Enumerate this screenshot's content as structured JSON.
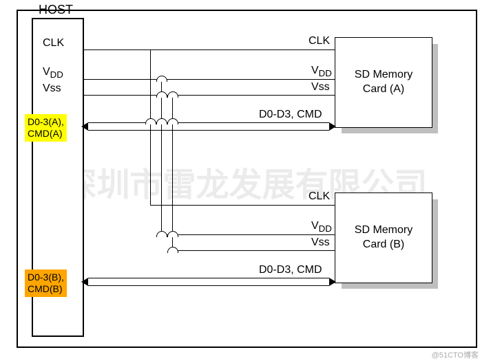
{
  "frame": {
    "title": "HOST"
  },
  "host": {
    "signals": {
      "clk": "CLK",
      "vdd": "V",
      "vdd_sub": "DD",
      "vss": "Vss"
    },
    "highlightA": {
      "line1": "D0-3(A),",
      "line2": "CMD(A)"
    },
    "highlightB": {
      "line1": "D0-3(B),",
      "line2": "CMD(B)"
    }
  },
  "busLabelA": "D0-D3, CMD",
  "busLabelB": "D0-D3, CMD",
  "cardA": {
    "clk": "CLK",
    "vdd": "V",
    "vdd_sub": "DD",
    "vss": "Vss",
    "name1": "SD Memory",
    "name2": "Card (A)"
  },
  "cardB": {
    "clk": "CLK",
    "vdd": "V",
    "vdd_sub": "DD",
    "vss": "Vss",
    "name1": "SD Memory",
    "name2": "Card (B)"
  },
  "watermark": "深圳市雷龙发展有限公司",
  "credit": "@51CTO博客"
}
